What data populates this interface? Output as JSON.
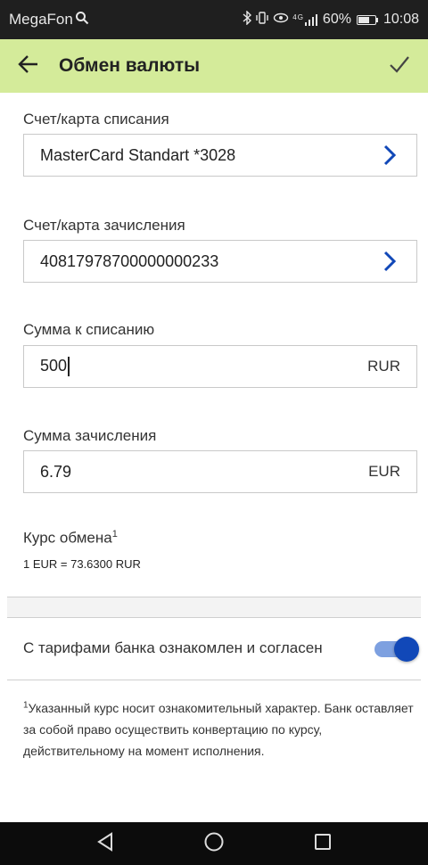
{
  "status_bar": {
    "carrier": "MegaFon",
    "network_type": "4G",
    "battery": "60%",
    "battery_level": 0.6,
    "time": "10:08"
  },
  "app_bar": {
    "title": "Обмен валюты"
  },
  "form": {
    "debit_account": {
      "label": "Счет/карта списания",
      "value": "MasterCard Standart *3028"
    },
    "credit_account": {
      "label": "Счет/карта зачисления",
      "value": "40817978700000000233"
    },
    "debit_amount": {
      "label": "Сумма к списанию",
      "value": "500",
      "currency": "RUR"
    },
    "credit_amount": {
      "label": "Сумма зачисления",
      "value": "6.79",
      "currency": "EUR"
    }
  },
  "rate": {
    "title": "Курс обмена",
    "footnote_mark": "1",
    "value": "1 EUR = 73.6300 RUR"
  },
  "agreement": {
    "label": "С тарифами банка ознакомлен и согласен",
    "checked": true
  },
  "footnote": {
    "mark": "1",
    "text": "Указанный курс носит ознакомительный характер. Банк оставляет за собой право осуществить конвертацию по курсу, действительному на момент исполнения."
  },
  "colors": {
    "app_bar_bg": "#d4eb9a",
    "accent": "#1148b8",
    "toggle_track": "#7da0e0"
  },
  "icons": {
    "back": "arrow-left-icon",
    "confirm": "check-icon",
    "chevron": "chevron-right-icon"
  }
}
